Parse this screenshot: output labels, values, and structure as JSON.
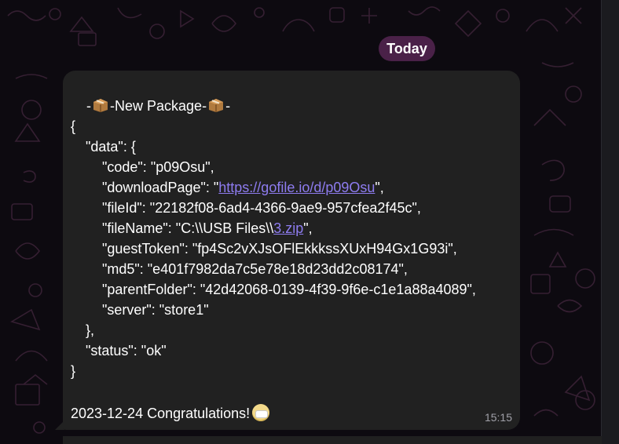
{
  "date_separator": "Today",
  "message": {
    "header_before": "-",
    "header_text": "-New Package-",
    "header_after": "-",
    "header_icon": "package-icon",
    "json_lines": {
      "open_brace": "{",
      "data_key": "\"data\": {",
      "code": "\"code\": \"p09Osu\",",
      "download_prefix": "\"downloadPage\": \"",
      "download_link": "https://gofile.io/d/p09Osu",
      "download_suffix": "\",",
      "fileid": "\"fileId\": \"22182f08-6ad4-4366-9ae9-957cfea2f45c\",",
      "filename_prefix": "\"fileName\": \"C:\\\\USB Files\\\\",
      "filename_link": "3.zip",
      "filename_suffix": "\",",
      "guest_token": "\"guestToken\": \"fp4Sc2vXJsOFlEkkkssXUxH94Gx1G93i\",",
      "md5": "\"md5\": \"e401f7982da7c5e78e18d23dd2c08174\",",
      "parent_folder": "\"parentFolder\": \"42d42068-0139-4f39-9f6e-c1e1a88a4089\",",
      "server": "\"server\": \"store1\"",
      "close_inner": "},",
      "status": "\"status\": \"ok\"",
      "close_brace": "}"
    },
    "footer_text": "2023-12-24 Congratulations!",
    "footer_emoji": "grimace-emoji",
    "time": "15:15"
  }
}
